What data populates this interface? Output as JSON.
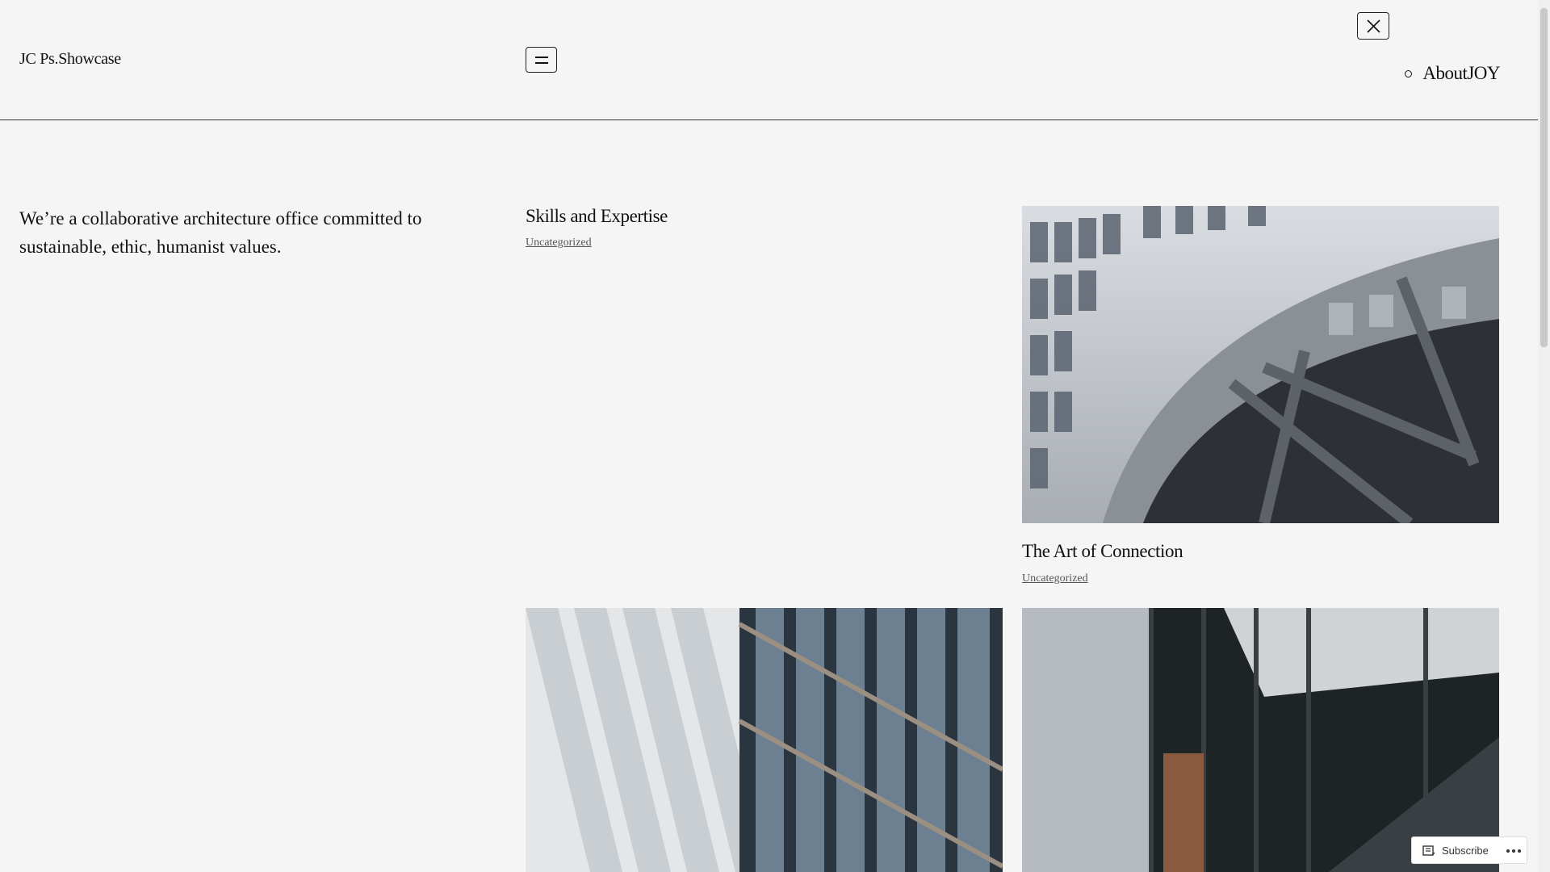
{
  "header": {
    "site_title": "JC Ps.Showcase",
    "nav": [
      {
        "label": "About"
      },
      {
        "label": "JOY"
      }
    ]
  },
  "intro": {
    "tagline": "We’re a collaborative architecture office committed to sustainable, ethic, humanist values."
  },
  "posts": [
    {
      "title": "Skills and Expertise",
      "category": "Uncategorized"
    },
    {
      "title": "The Art of Connection",
      "category": "Uncategorized"
    }
  ],
  "subscribe": {
    "label": "Subscribe"
  }
}
